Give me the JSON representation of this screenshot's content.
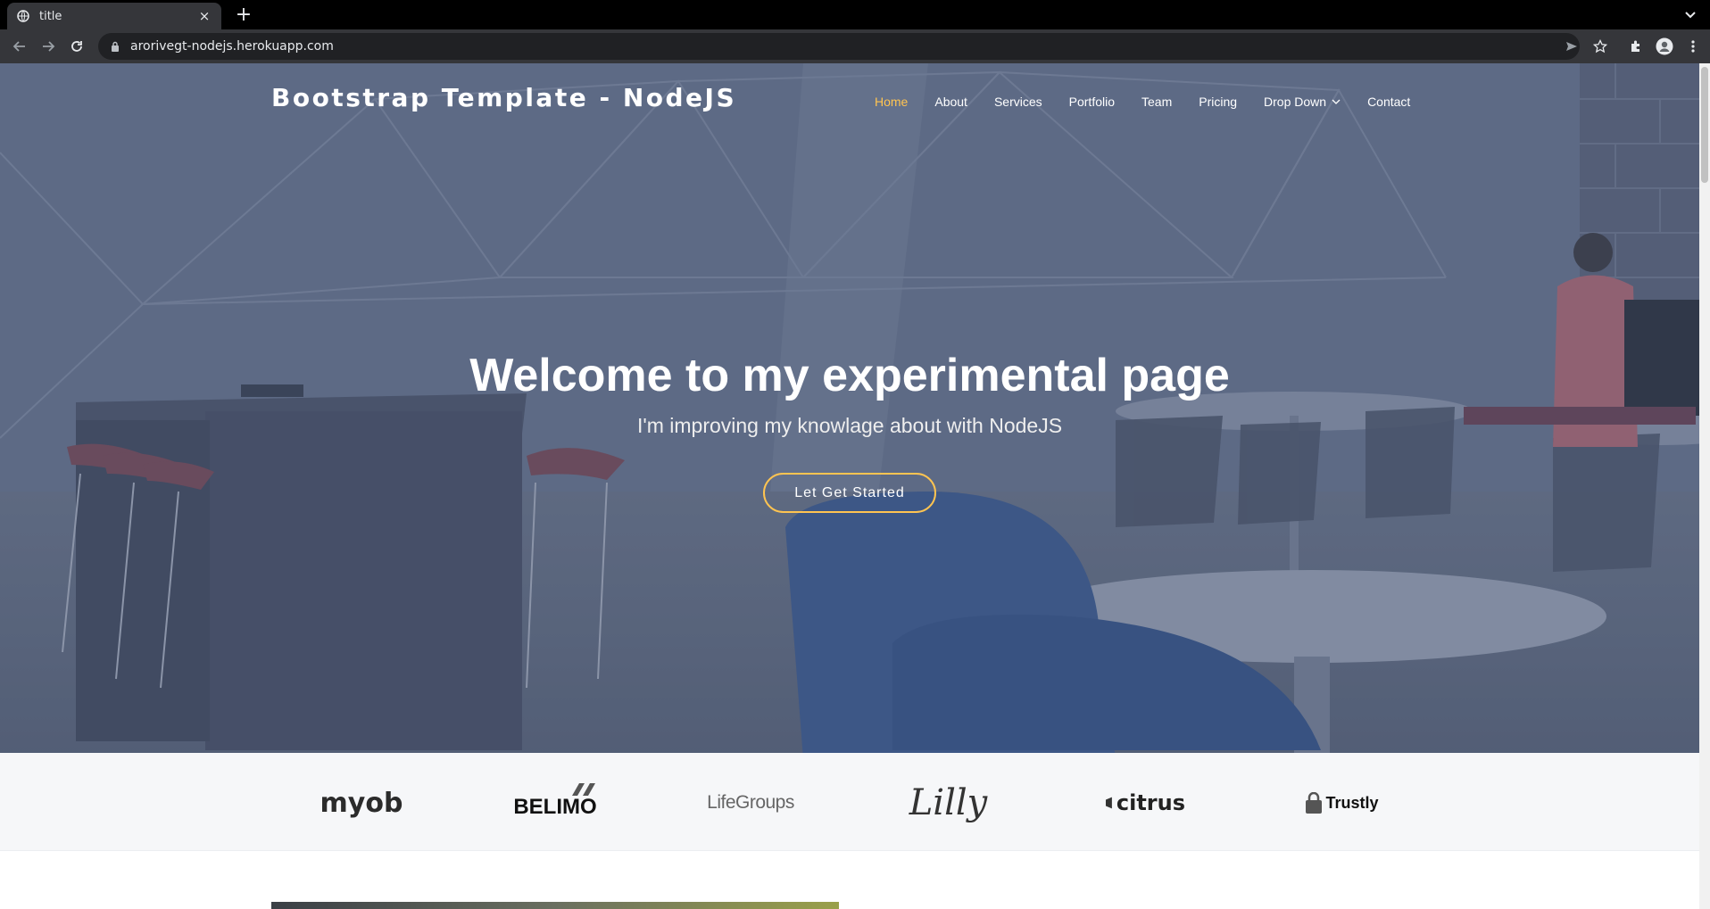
{
  "browser": {
    "tab_title": "title",
    "tab_close": "×",
    "new_tab": "+",
    "url": "arorivegt-nodejs.herokuapp.com"
  },
  "header": {
    "logo": "Bootstrap Template - NodeJS",
    "nav": [
      {
        "label": "Home",
        "active": true
      },
      {
        "label": "About"
      },
      {
        "label": "Services"
      },
      {
        "label": "Portfolio"
      },
      {
        "label": "Team"
      },
      {
        "label": "Pricing"
      },
      {
        "label": "Drop Down"
      },
      {
        "label": "Contact"
      }
    ]
  },
  "hero": {
    "title": "Welcome to my experimental page",
    "subtitle": "I'm improving my knowlage about with NodeJS",
    "button": "Let Get Started"
  },
  "clients": [
    {
      "name": "myob"
    },
    {
      "name": "BELIMO"
    },
    {
      "name": "LifeGroups"
    },
    {
      "name": "Lilly"
    },
    {
      "name": "citrus"
    },
    {
      "name": "Trustly"
    }
  ],
  "colors": {
    "accent": "#ffc451",
    "chrome_dark": "#35363a",
    "hero_overlay": "#3c4e73"
  }
}
